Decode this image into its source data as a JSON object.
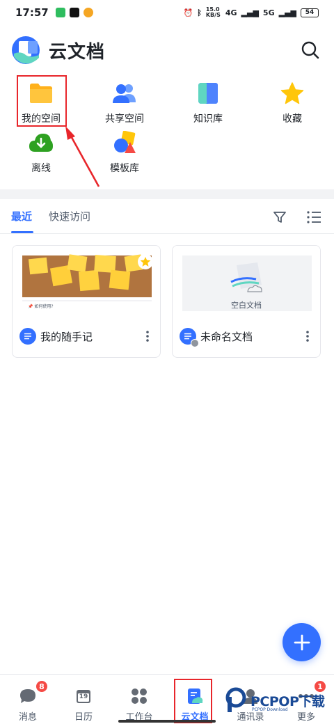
{
  "status_bar": {
    "time": "17:57",
    "network": "15.0 KB/S",
    "signal_1": "4G",
    "signal_2": "5G",
    "battery": "54"
  },
  "header": {
    "title": "云文档"
  },
  "quick_access": [
    {
      "label": "我的空间",
      "icon": "folder-icon"
    },
    {
      "label": "共享空间",
      "icon": "people-icon"
    },
    {
      "label": "知识库",
      "icon": "knowledge-base-icon"
    },
    {
      "label": "收藏",
      "icon": "star-icon"
    },
    {
      "label": "离线",
      "icon": "download-icon"
    },
    {
      "label": "模板库",
      "icon": "template-icon"
    }
  ],
  "tabs": {
    "recent": "最近",
    "quick_access": "快速访问"
  },
  "documents": [
    {
      "title": "我的随手记",
      "thumb_caption": "📌 如何使用?",
      "starred": true
    },
    {
      "title": "未命名文档",
      "thumb_caption": "空白文档",
      "starred": false
    }
  ],
  "bottom_nav": [
    {
      "label": "消息",
      "badge": "8",
      "icon": "chat-icon"
    },
    {
      "label": "日历",
      "icon": "calendar-icon",
      "date": "19"
    },
    {
      "label": "工作台",
      "icon": "grid-icon"
    },
    {
      "label": "云文档",
      "icon": "cloud-doc-icon",
      "active": true
    },
    {
      "label": "通讯录",
      "icon": "contacts-icon"
    },
    {
      "label": "更多",
      "badge": "1",
      "icon": "more-icon"
    }
  ],
  "watermark": {
    "text": "PCPOP下载",
    "sub": "PCPOP Download"
  },
  "colors": {
    "accent": "#3370ff",
    "annotation": "#e8262b",
    "badge": "#f54a45"
  }
}
